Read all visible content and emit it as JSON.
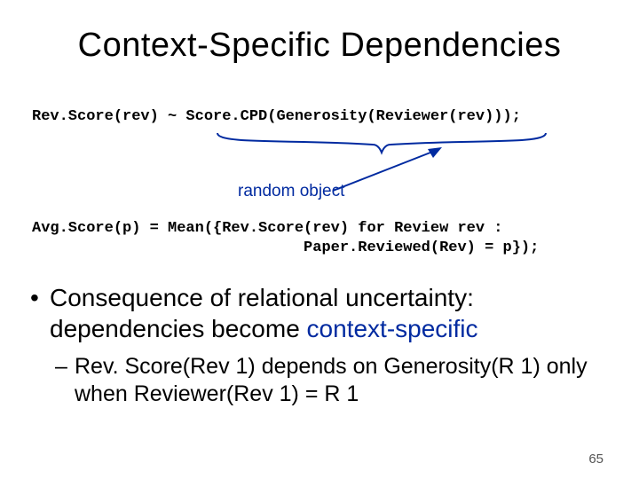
{
  "title": "Context-Specific Dependencies",
  "code1": "Rev.Score(rev) ~ Score.CPD(Generosity(Reviewer(rev)));",
  "random_label": "random object",
  "code2_line1": "Avg.Score(p) = Mean({Rev.Score(rev) for Review rev :",
  "code2_line2": "                              Paper.Reviewed(Rev) = p});",
  "bullet_pre": "Consequence of relational uncertainty: dependencies become ",
  "bullet_hl": "context-specific",
  "sub": "Rev. Score(Rev 1) depends on Generosity(R 1) only when Reviewer(Rev 1) = R 1",
  "page": "65"
}
